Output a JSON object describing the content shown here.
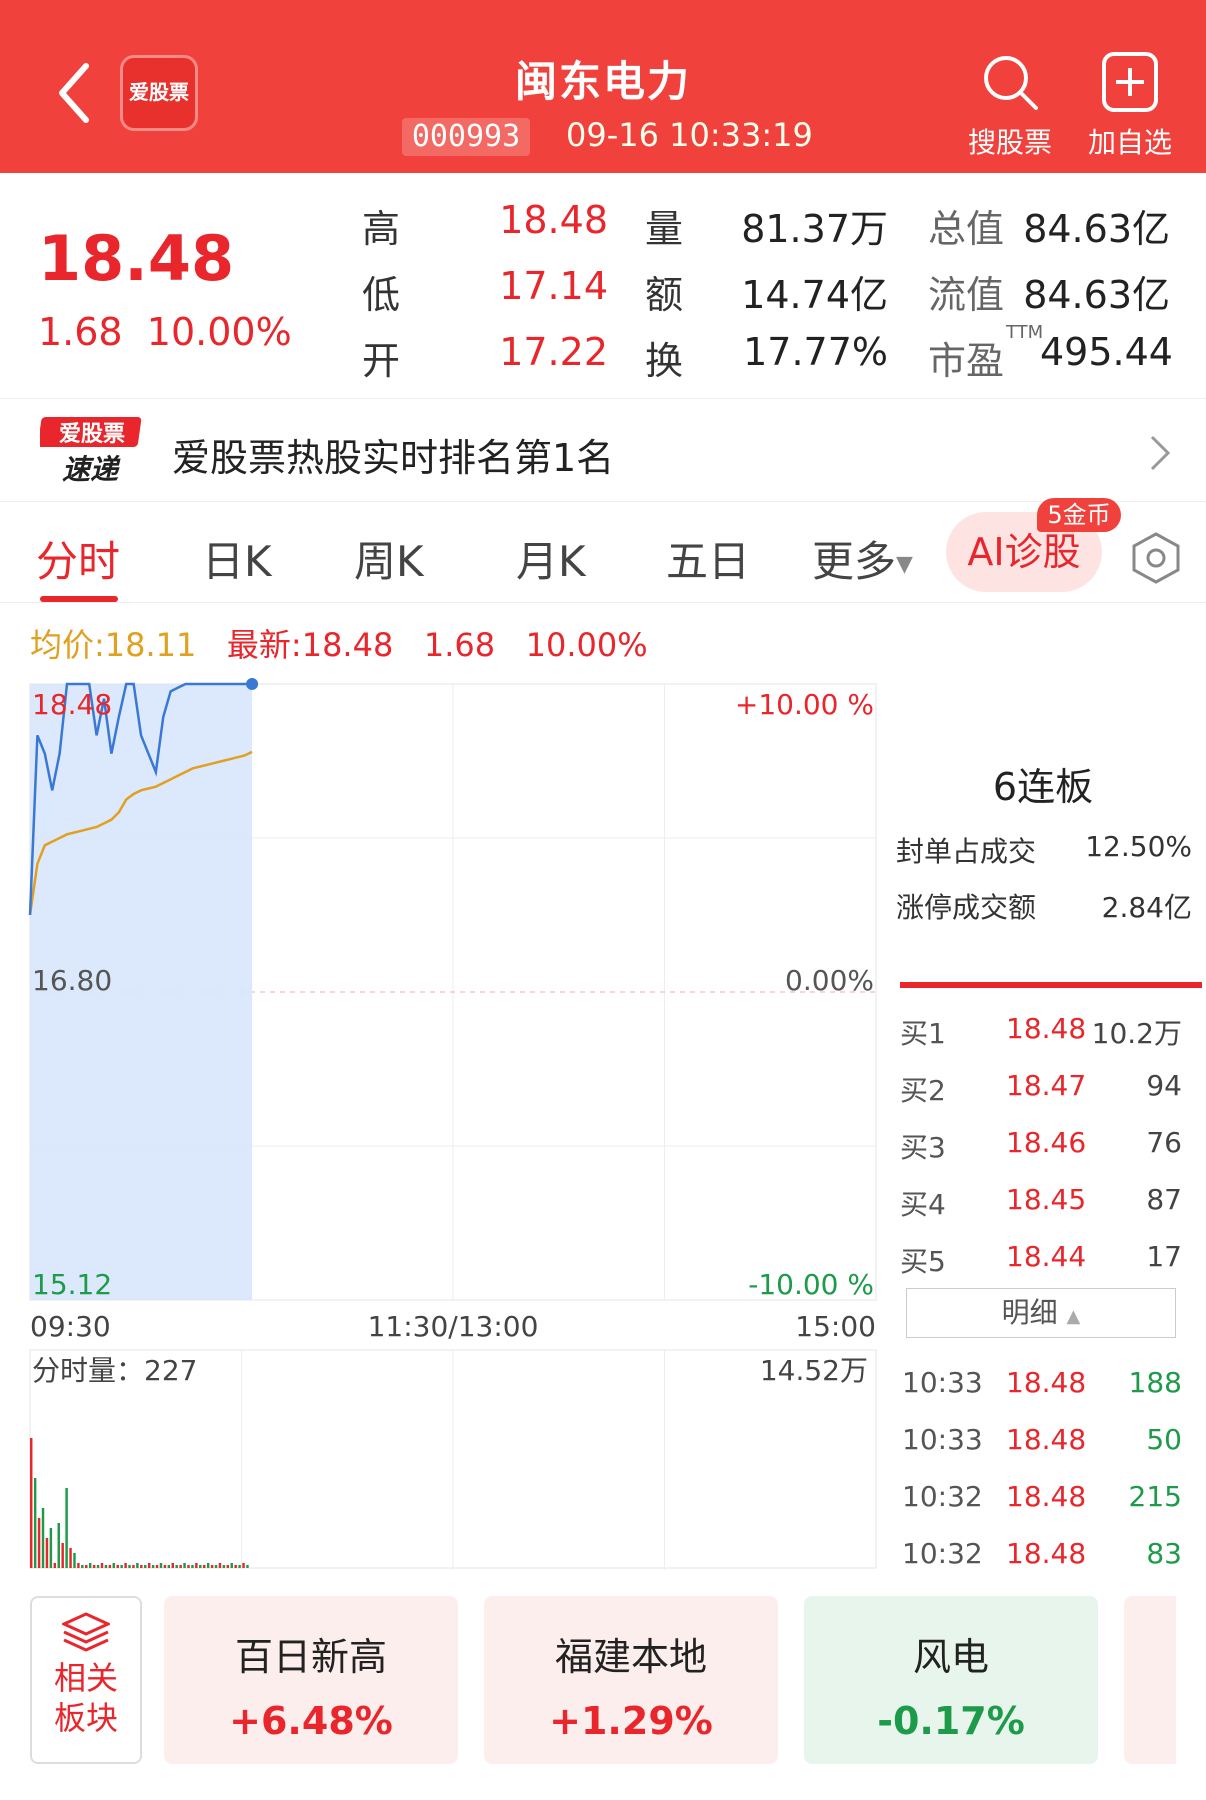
{
  "header": {
    "app_logo_text": "爱股票",
    "stock_name": "闽东电力",
    "stock_code": "000993",
    "datetime": "09-16 10:33:19",
    "search_label": "搜股票",
    "add_label": "加自选"
  },
  "quote": {
    "price": "18.48",
    "change": "1.68",
    "change_pct": "10.00%",
    "rows": [
      {
        "l1": "高",
        "v1": "18.48",
        "l2": "量",
        "v2": "81.37万",
        "l3": "总值",
        "v3": "84.63亿"
      },
      {
        "l1": "低",
        "v1": "17.14",
        "l2": "额",
        "v2": "14.74亿",
        "l3": "流值",
        "v3": "84.63亿"
      },
      {
        "l1": "开",
        "v1": "17.22",
        "l2": "换",
        "v2": "17.77%",
        "l3": "市盈",
        "v3": "495.44"
      }
    ],
    "ttm": "TTM"
  },
  "rank_banner": {
    "logo_top": "爱股票",
    "logo_bottom": "速递",
    "text": "爱股票热股实时排名第1名"
  },
  "tabs": {
    "items": [
      "分时",
      "日K",
      "周K",
      "月K",
      "五日",
      "更多"
    ],
    "ai_label": "AI诊股",
    "ai_badge": "5金币"
  },
  "chart_info": {
    "avg_label": "均价:18.11",
    "latest_label": "最新:18.48",
    "change": "1.68",
    "change_pct": "10.00%"
  },
  "chart_data": {
    "type": "line",
    "title": "",
    "y_left_ticks": [
      "18.48",
      "16.80",
      "15.12"
    ],
    "y_right_ticks": [
      "+10.00 %",
      "0.00%",
      "-10.00 %"
    ],
    "x_ticks": [
      "09:30",
      "11:30/13:00",
      "15:00"
    ],
    "ylim": [
      15.12,
      18.48
    ],
    "prev_close": 16.8,
    "series": [
      {
        "values": [
          17.22,
          18.2,
          18.1,
          17.9,
          18.1,
          18.48,
          18.48,
          18.48,
          18.48,
          18.2,
          18.4,
          18.1,
          18.3,
          18.48,
          18.48,
          18.2,
          18.1,
          18.0,
          18.3,
          18.44,
          18.46,
          18.48,
          18.48,
          18.48,
          18.48,
          18.48,
          18.48,
          18.48,
          18.48,
          18.48,
          18.48
        ]
      },
      {
        "values": [
          17.22,
          17.5,
          17.6,
          17.62,
          17.64,
          17.66,
          17.67,
          17.68,
          17.69,
          17.7,
          17.72,
          17.74,
          17.78,
          17.85,
          17.88,
          17.9,
          17.91,
          17.92,
          17.94,
          17.96,
          17.98,
          18.0,
          18.02,
          18.03,
          18.04,
          18.05,
          18.06,
          18.07,
          18.08,
          18.09,
          18.11
        ]
      }
    ],
    "volume_label": "分时量：227",
    "volume_max_label": "14.52万"
  },
  "side_panel": {
    "board": "6连板",
    "seal_ratio_label": "封单占成交",
    "seal_ratio": "12.50%",
    "limit_amount_label": "涨停成交额",
    "limit_amount": "2.84亿",
    "bids": [
      {
        "label": "买1",
        "price": "18.48",
        "vol": "10.2万"
      },
      {
        "label": "买2",
        "price": "18.47",
        "vol": "94"
      },
      {
        "label": "买3",
        "price": "18.46",
        "vol": "76"
      },
      {
        "label": "买4",
        "price": "18.45",
        "vol": "87"
      },
      {
        "label": "买5",
        "price": "18.44",
        "vol": "17"
      }
    ],
    "detail_label": "明细",
    "trades": [
      {
        "time": "10:33",
        "price": "18.48",
        "vol": "188"
      },
      {
        "time": "10:33",
        "price": "18.48",
        "vol": "50"
      },
      {
        "time": "10:32",
        "price": "18.48",
        "vol": "215"
      },
      {
        "time": "10:32",
        "price": "18.48",
        "vol": "83"
      }
    ]
  },
  "sectors": {
    "label_top": "相关",
    "label_bottom": "板块",
    "items": [
      {
        "name": "百日新高",
        "value": "+6.48%"
      },
      {
        "name": "福建本地",
        "value": "+1.29%"
      },
      {
        "name": "风电",
        "value": "-0.17%"
      }
    ]
  },
  "colors": {
    "brand_red": "#f0413c",
    "up": "#e8262b",
    "down": "#1d9a4a",
    "avg_line": "#e0a020",
    "price_line": "#3a78d6"
  }
}
